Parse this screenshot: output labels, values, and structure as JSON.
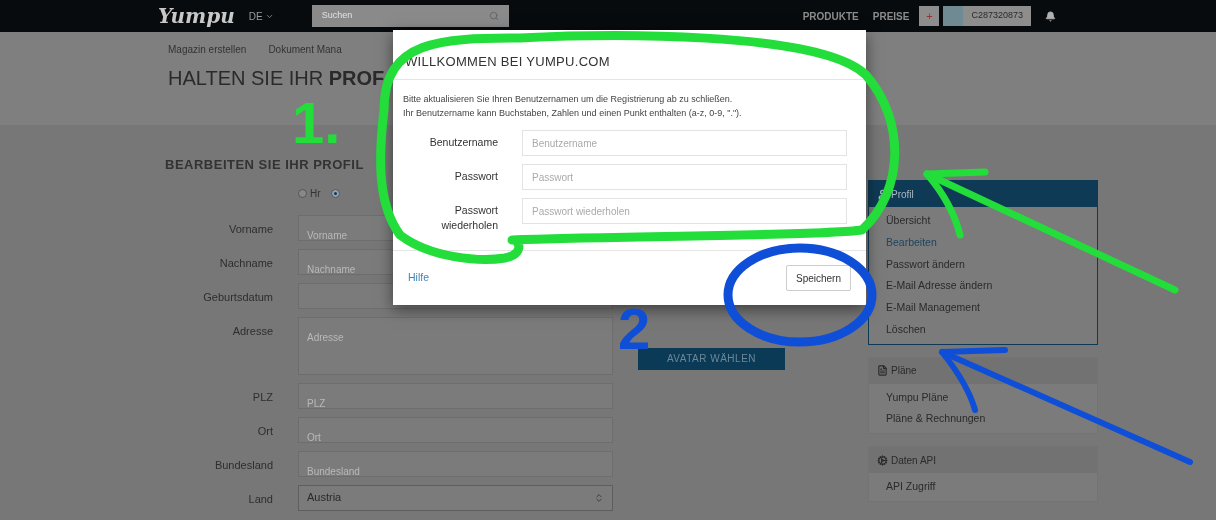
{
  "nav": {
    "logo": "Yumpu",
    "language": "DE",
    "search_placeholder": "Suchen",
    "links": [
      "PRODUKTE",
      "PREISE"
    ],
    "add_button": "+",
    "user": "C287320873"
  },
  "breadcrumb": [
    "Magazin erstellen",
    "Dokument Mana"
  ],
  "page_title": "HALTEN SIE IHR **PROF**",
  "form": {
    "heading": "BEARBEITEN SIE IHR PROFIL",
    "salutation": [
      {
        "label": "Hr",
        "selected": false
      },
      {
        "selected": true
      }
    ],
    "fields": [
      {
        "kind": "input",
        "label": "Vorname",
        "placeholder": "Vorname"
      },
      {
        "kind": "input",
        "label": "Nachname",
        "placeholder": "Nachname"
      },
      {
        "kind": "input",
        "label": "Geburtsdatum"
      },
      {
        "kind": "textarea",
        "label": "Adresse",
        "placeholder": "Adresse"
      },
      {
        "kind": "input",
        "label": "PLZ",
        "placeholder": "PLZ"
      },
      {
        "kind": "input",
        "label": "Ort",
        "placeholder": "Ort"
      },
      {
        "kind": "input",
        "label": "Bundesland",
        "placeholder": "Bundesland"
      },
      {
        "kind": "select",
        "label": "Land",
        "value": "Austria"
      }
    ]
  },
  "avatar_button": "AVATAR WÄHLEN",
  "sidebar": [
    {
      "kind": "profile",
      "title": "Profil",
      "highlighted": true,
      "items": [
        {
          "label": "Übersicht",
          "selected": false
        },
        {
          "label": "Bearbeiten",
          "selected": true
        },
        {
          "label": "Passwort ändern",
          "selected": false
        },
        {
          "label": "E-Mail Adresse ändern",
          "selected": false
        },
        {
          "label": "E-Mail Management",
          "selected": false
        },
        {
          "label": "Löschen",
          "selected": false
        }
      ]
    },
    {
      "kind": "plans",
      "title": "Pläne",
      "highlighted": false,
      "items": [
        {
          "label": "Yumpu Pläne",
          "selected": false
        },
        {
          "label": "Pläne & Rechnungen",
          "selected": false
        }
      ]
    },
    {
      "kind": "api",
      "title": "Daten API",
      "highlighted": false,
      "items": [
        {
          "label": "API Zugriff",
          "selected": false
        }
      ]
    }
  ],
  "modal": {
    "title": "WILLKOMMEN BEI YUMPU.COM",
    "description": [
      "Bitte aktualisieren Sie Ihren Benutzernamen um die Registrierung ab zu schließen.",
      "Ihr Benutzername kann Buchstaben, Zahlen und einen Punkt enthalten (a-z, 0-9, \".\")."
    ],
    "fields": [
      {
        "label": "Benutzername",
        "placeholder": "Benutzername"
      },
      {
        "label": "Passwort",
        "placeholder": "Passwort"
      },
      {
        "label": "Passwort wiederholen",
        "placeholder": "Passwort wiederholen"
      }
    ],
    "help_link": "Hilfe",
    "save_button": "Speichern"
  },
  "annotations": [
    {
      "number": "1.",
      "color": "#22dd3a"
    },
    {
      "number": "2",
      "color": "#0f4fd8"
    }
  ]
}
